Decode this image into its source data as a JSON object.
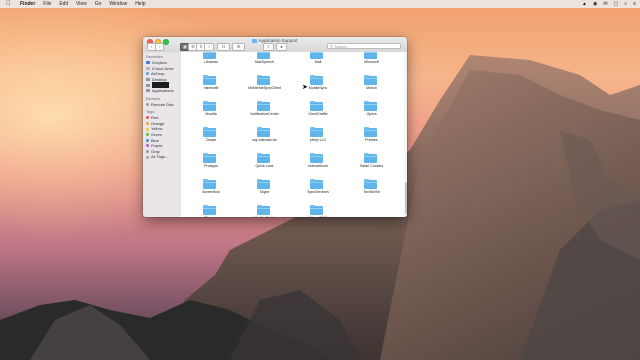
{
  "menubar": {
    "app_name": "Finder",
    "items": [
      "File",
      "Edit",
      "View",
      "Go",
      "Window",
      "Help"
    ],
    "status": [
      "▲",
      "◉",
      "✉",
      "▢",
      "⌕",
      "≡"
    ]
  },
  "window": {
    "title": "Application Support",
    "toolbar": {
      "back": "‹",
      "forward": "›",
      "views": [
        "▦",
        "☰",
        "⫴",
        "⫶"
      ],
      "arrange": "☷",
      "action": "⚙",
      "share": "⇪",
      "tag": "●",
      "search_placeholder": "Search"
    },
    "sidebar": {
      "favorites_header": "Favorites",
      "favorites": [
        "Dropbox",
        "iCloud Drive",
        "AirDrop",
        "Desktop",
        "",
        "Applications"
      ],
      "devices_header": "Devices",
      "devices": [
        "Remote Disc"
      ],
      "tags_header": "Tags",
      "tags": [
        {
          "label": "Red",
          "color": "#f0504a"
        },
        {
          "label": "Orange",
          "color": "#f5a03a"
        },
        {
          "label": "Yellow",
          "color": "#efd03c"
        },
        {
          "label": "Green",
          "color": "#54c04a"
        },
        {
          "label": "Blue",
          "color": "#3d8ee8"
        },
        {
          "label": "Purple",
          "color": "#a664d6"
        },
        {
          "label": "Gray",
          "color": "#9b9b9b"
        },
        {
          "label": "All Tags...",
          "color": ""
        }
      ]
    },
    "folders": [
      "Librarian",
      "MacSpeech",
      "Mail",
      "Microsoft",
      "minecraft",
      "MobileMeSyncClient",
      "MobileSync",
      "Motion",
      "Mozilla",
      "NotificationCenter",
      "OmniGraffle",
      "Opera",
      "Oracle",
      "org.videolan.vlc",
      "pleep LLC",
      "Preview",
      "ProApps",
      "Quick Look",
      "rednotebook",
      "Safari Cookies",
      "Screenflow",
      "Skype",
      "SyncServices",
      "TechSmith",
      "Titanium",
      "WebEx Folder",
      "Wraps2013",
      ""
    ]
  }
}
